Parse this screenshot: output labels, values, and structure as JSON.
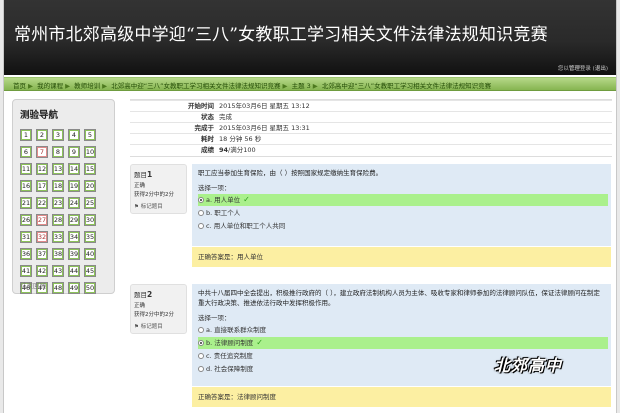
{
  "header": {
    "site_title": "常州市北郊高级中学迎“三八”女教职工学习相关文件法律法规知识竞赛",
    "login_prefix": "您以",
    "login_user": "管理",
    "login_middle": "登录 (",
    "logout": "退出",
    "login_suffix": ")"
  },
  "breadcrumb": [
    "首页",
    "我的课程",
    "教师培训",
    "北郊高中迎“三八”女教职工学习相关文件法律法规知识竞赛",
    "主题 3",
    "北郊高中迎“三八”女教职工学习相关文件法律法规知识竞赛"
  ],
  "sidebar": {
    "title": "测验导航",
    "buttons": [
      "1",
      "2",
      "3",
      "4",
      "5",
      "6",
      "7",
      "8",
      "9",
      "10",
      "11",
      "12",
      "13",
      "14",
      "15",
      "16",
      "17",
      "18",
      "19",
      "20",
      "21",
      "22",
      "23",
      "24",
      "25",
      "26",
      "27",
      "28",
      "29",
      "30",
      "31",
      "32",
      "33",
      "34",
      "35",
      "36",
      "37",
      "38",
      "39",
      "40",
      "41",
      "42",
      "43",
      "44",
      "45",
      "46",
      "47",
      "48",
      "49",
      "50"
    ],
    "wrong_buttons": [
      "7",
      "27",
      "32"
    ],
    "finish": "结束回顾"
  },
  "summary": [
    {
      "label": "开始时间",
      "value": "2015年03月6日 星期五 13:12"
    },
    {
      "label": "状态",
      "value": "完成"
    },
    {
      "label": "完成于",
      "value": "2015年03月6日 星期五 13:31"
    },
    {
      "label": "耗时",
      "value": "18 分钟 56 秒"
    },
    {
      "label": "成绩",
      "value_bold": "94",
      "value": "/满分100"
    }
  ],
  "questions": [
    {
      "prefix": "题目",
      "number": "1",
      "state": "正确",
      "grade": "获得2分中的2分",
      "flag": "标记题目",
      "stem": "职工应当参加生育保险，由（ ）按照国家规定缴纳生育保险费。",
      "prompt": "选择一项：",
      "options": [
        {
          "text": "a. 用人单位",
          "selected": true,
          "correct": true
        },
        {
          "text": "b. 职工个人",
          "selected": false,
          "correct": false
        },
        {
          "text": "c. 用人单位和职工个人共同",
          "selected": false,
          "correct": false
        }
      ],
      "feedback": "正确答案是：用人单位"
    },
    {
      "prefix": "题目",
      "number": "2",
      "state": "正确",
      "grade": "获得2分中的2分",
      "flag": "标记题目",
      "stem": "中共十八届四中全会提出，积极推行政府的（ ），建立政府法制机构人员为主体、吸收专家和律师参加的法律顾问队伍，保证法律顾问在制定重大行政决策、推进依法行政中发挥积极作用。",
      "prompt": "选择一项：",
      "options": [
        {
          "text": "a. 直接联系群众制度",
          "selected": false,
          "correct": false
        },
        {
          "text": "b. 法律顾问制度",
          "selected": true,
          "correct": true
        },
        {
          "text": "c. 责任追究制度",
          "selected": false,
          "correct": false
        },
        {
          "text": "d. 社会保障制度",
          "selected": false,
          "correct": false
        }
      ],
      "feedback": "正确答案是：法律顾问制度"
    }
  ],
  "watermark": "北郊高中"
}
